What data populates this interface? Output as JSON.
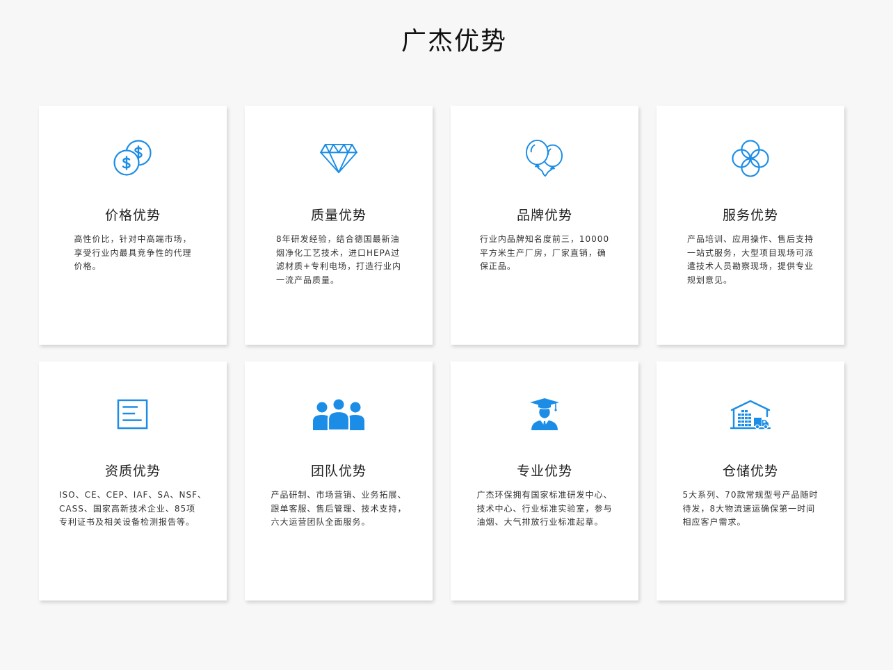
{
  "page": {
    "title": "广杰优势"
  },
  "colors": {
    "accent": "#1b8de6",
    "background": "#f7f7f7",
    "card": "#ffffff",
    "title_text": "#222222",
    "body_text": "#333333"
  },
  "cards": [
    {
      "icon": "coins-icon",
      "title": "价格优势",
      "desc": [
        "高性价比，针对中高端市场，",
        "享受行业内最具竞争性的代理",
        "价格。"
      ]
    },
    {
      "icon": "diamond-icon",
      "title": "质量优势",
      "desc": [
        "8年研发经验，结合德国最新油",
        "烟净化工艺技术，进口HEPA过",
        "滤材质+专利电场，打造行业内",
        "一流产品质量。"
      ]
    },
    {
      "icon": "balloons-icon",
      "title": "品牌优势",
      "desc": [
        "行业内品牌知名度前三，10000",
        "平方米生产厂房，厂家直销，确",
        "保正品。"
      ]
    },
    {
      "icon": "interlocking-circles-icon",
      "title": "服务优势",
      "desc": [
        "产品培训、应用操作、售后支持",
        "一站式服务，大型项目现场可派",
        "遣技术人员勘察现场，提供专业",
        "规划意见。"
      ]
    },
    {
      "icon": "document-icon",
      "title": "资质优势",
      "desc": [
        "ISO、CE、CEP、IAF、SA、NSF、",
        "CASS、国家高新技术企业、85项",
        "专利证书及相关设备检测报告等。"
      ]
    },
    {
      "icon": "team-icon",
      "title": "团队优势",
      "desc": [
        "产品研制、市场营销、业务拓展、",
        "跟单客服、售后管理、技术支持，",
        "六大运营团队全面服务。"
      ]
    },
    {
      "icon": "graduate-icon",
      "title": "专业优势",
      "desc": [
        "广杰环保拥有国家标准研发中心、",
        "技术中心、行业标准实验室，参与",
        "油烟、大气排放行业标准起草。"
      ]
    },
    {
      "icon": "warehouse-truck-icon",
      "title": "仓储优势",
      "desc": [
        "5大系列、70款常规型号产品随时",
        "待发，8大物流速运确保第一时间",
        "相应客户需求。"
      ]
    }
  ]
}
